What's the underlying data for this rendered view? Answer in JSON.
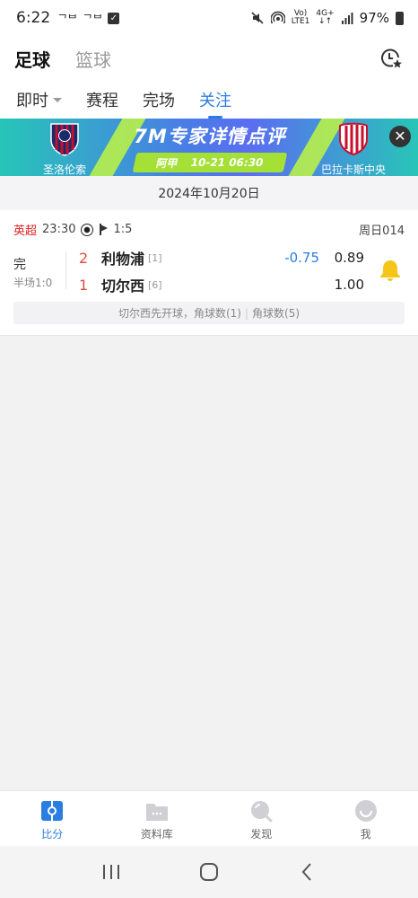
{
  "status_bar": {
    "time": "6:22",
    "left_icons": [
      "ᄀᄇ",
      "ᄀᄇ"
    ],
    "network_top": "Vo)",
    "network_bottom": "LTE1",
    "net_type_top": "4G+",
    "net_type_bottom": "↓↑",
    "battery": "97%"
  },
  "header": {
    "tabs": [
      {
        "label": "足球",
        "active": true
      },
      {
        "label": "篮球",
        "active": false
      }
    ]
  },
  "subtabs": [
    {
      "label": "即时",
      "has_dropdown": true,
      "active": false
    },
    {
      "label": "赛程",
      "active": false
    },
    {
      "label": "完场",
      "active": false
    },
    {
      "label": "关注",
      "active": true
    }
  ],
  "banner": {
    "title": "7M专家详情点评",
    "league": "阿甲",
    "datetime": "10-21 06:30",
    "home_team": "圣洛伦索",
    "away_team": "巴拉卡斯中央",
    "close_symbol": "✕"
  },
  "date_label": "2024年10月20日",
  "match": {
    "league": "英超",
    "time": "23:30",
    "corners": "1:5",
    "code": "周日014",
    "status": "完",
    "half_time": "半场1:0",
    "home": {
      "score": "2",
      "name": "利物浦",
      "rank": "[1]",
      "handicap": "-0.75",
      "odds": "0.89"
    },
    "away": {
      "score": "1",
      "name": "切尔西",
      "rank": "[6]",
      "odds": "1.00"
    },
    "footer_kickoff": "切尔西先开球，角球数(1)",
    "footer_sep": "|",
    "footer_corners": "角球数(5)"
  },
  "bottom_nav": [
    {
      "label": "比分",
      "icon": "score-icon",
      "active": true
    },
    {
      "label": "资料库",
      "icon": "database-icon",
      "active": false
    },
    {
      "label": "发现",
      "icon": "discover-icon",
      "active": false
    },
    {
      "label": "我",
      "icon": "profile-icon",
      "active": false
    }
  ],
  "colors": {
    "accent": "#2a7de1",
    "league_red": "#dd2222",
    "score_red": "#e34a3a",
    "bell_yellow": "#f5c518"
  }
}
